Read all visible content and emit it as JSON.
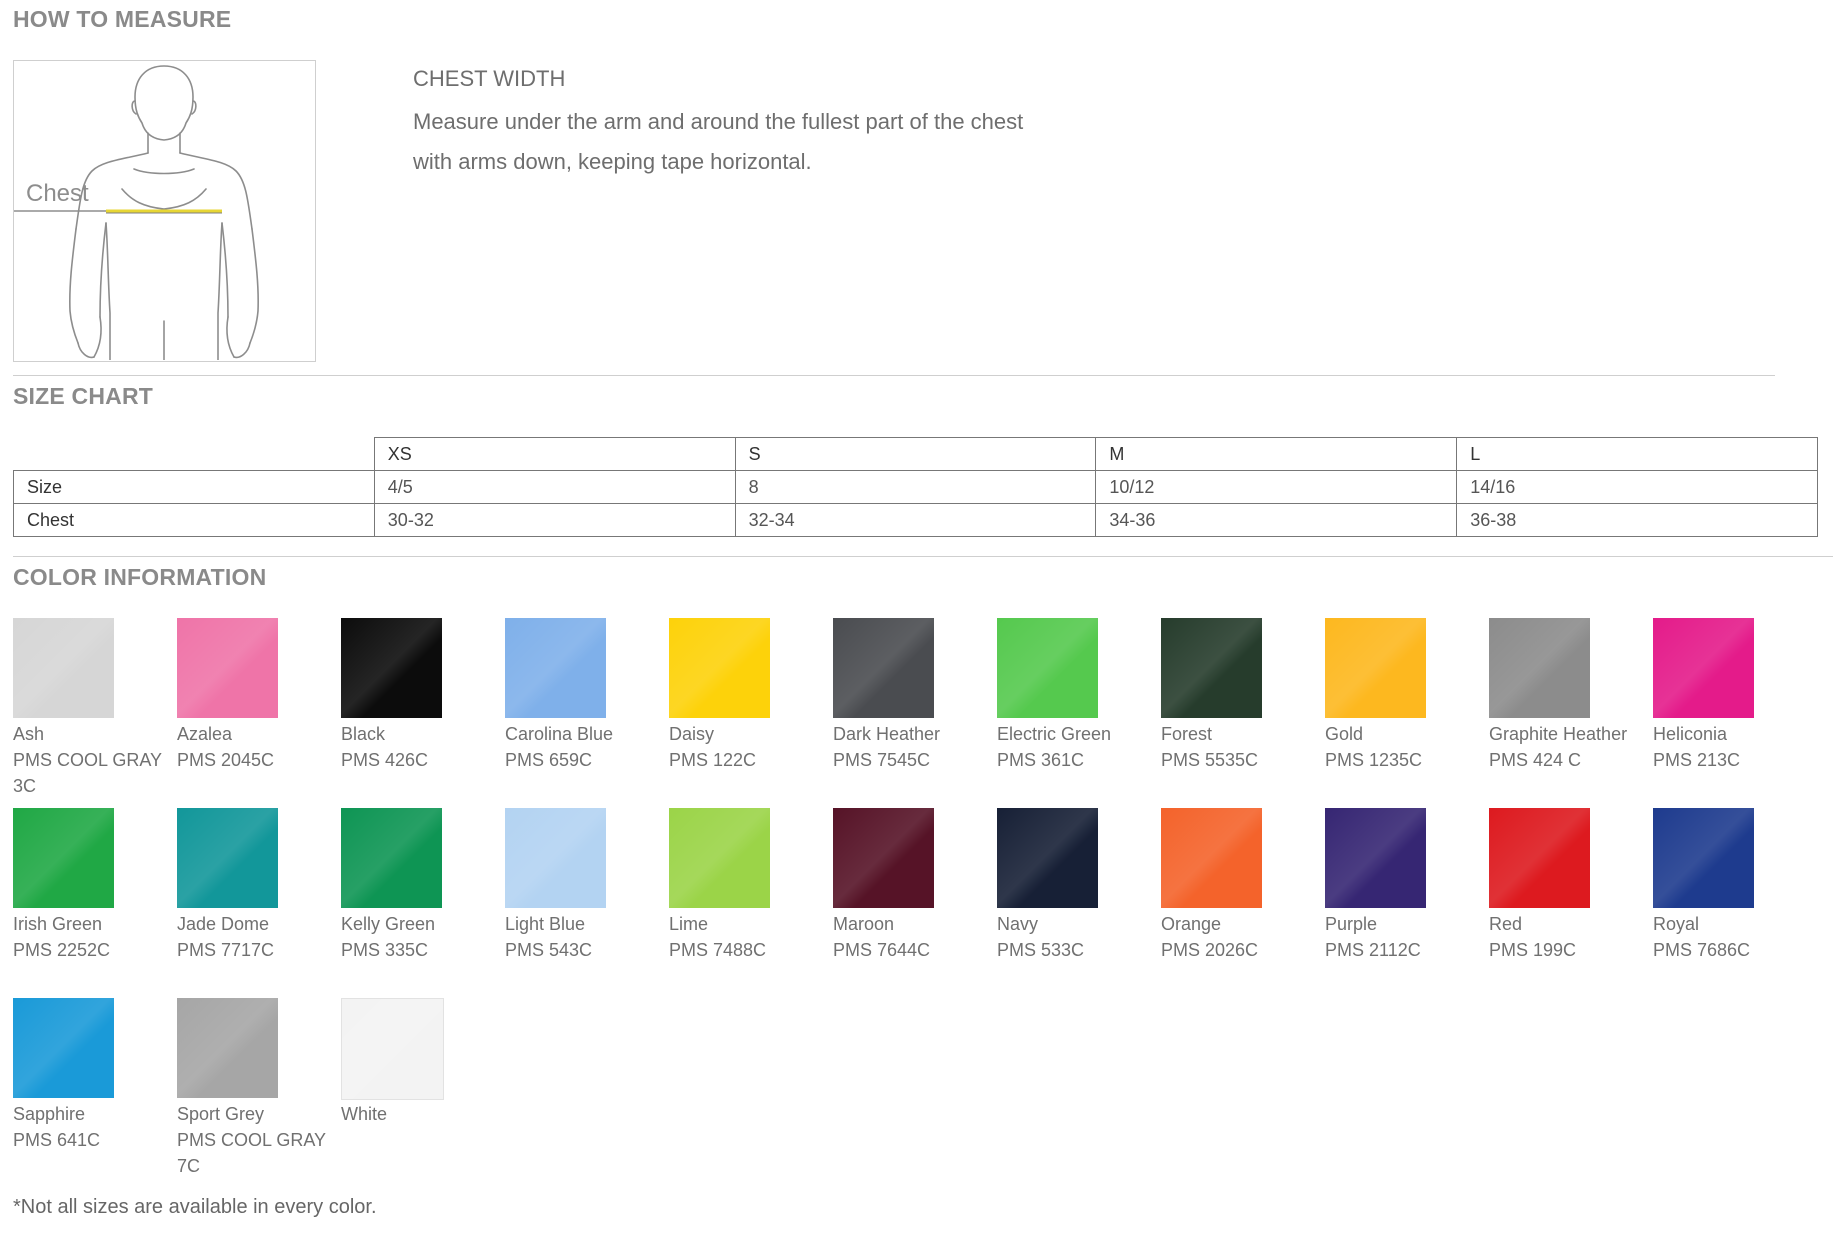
{
  "how_to_measure": {
    "title": "HOW TO MEASURE",
    "figure_label": "Chest",
    "heading": "CHEST WIDTH",
    "line1": "Measure under the arm and around the fullest part of the chest",
    "line2": "with arms down, keeping tape horizontal."
  },
  "size_chart": {
    "title": "SIZE CHART",
    "columns": [
      "XS",
      "S",
      "M",
      "L"
    ],
    "rows": [
      {
        "label": "Size",
        "values": [
          "4/5",
          "8",
          "10/12",
          "14/16"
        ]
      },
      {
        "label": "Chest",
        "values": [
          "30-32",
          "32-34",
          "34-36",
          "36-38"
        ]
      }
    ]
  },
  "color_info": {
    "title": "COLOR INFORMATION",
    "colors": [
      {
        "name": "Ash",
        "pms": "PMS COOL GRAY 3C",
        "hex": "#d6d6d6"
      },
      {
        "name": "Azalea",
        "pms": "PMS 2045C",
        "hex": "#ef74a8"
      },
      {
        "name": "Black",
        "pms": "PMS 426C",
        "hex": "#0c0c0c"
      },
      {
        "name": "Carolina Blue",
        "pms": "PMS 659C",
        "hex": "#7fb0ea"
      },
      {
        "name": "Daisy",
        "pms": "PMS 122C",
        "hex": "#fdd20a"
      },
      {
        "name": "Dark Heather",
        "pms": "PMS 7545C",
        "hex": "#4a4c50"
      },
      {
        "name": "Electric Green",
        "pms": "PMS 361C",
        "hex": "#55c94e"
      },
      {
        "name": "Forest",
        "pms": "PMS 5535C",
        "hex": "#263c2c"
      },
      {
        "name": "Gold",
        "pms": "PMS 1235C",
        "hex": "#fdb81f"
      },
      {
        "name": "Graphite Heather",
        "pms": "PMS 424 C",
        "hex": "#8c8c8c"
      },
      {
        "name": "Heliconia",
        "pms": "PMS 213C",
        "hex": "#e41b8a"
      },
      {
        "name": "Irish Green",
        "pms": "PMS 2252C",
        "hex": "#20a845"
      },
      {
        "name": "Jade Dome",
        "pms": "PMS 7717C",
        "hex": "#12979a"
      },
      {
        "name": "Kelly Green",
        "pms": "PMS 335C",
        "hex": "#0e9554"
      },
      {
        "name": "Light Blue",
        "pms": "PMS 543C",
        "hex": "#b3d3f2"
      },
      {
        "name": "Lime",
        "pms": "PMS 7488C",
        "hex": "#9bd448"
      },
      {
        "name": "Maroon",
        "pms": "PMS 7644C",
        "hex": "#561327"
      },
      {
        "name": "Navy",
        "pms": "PMS 533C",
        "hex": "#172036"
      },
      {
        "name": "Orange",
        "pms": "PMS 2026C",
        "hex": "#f4632b"
      },
      {
        "name": "Purple",
        "pms": "PMS 2112C",
        "hex": "#362673"
      },
      {
        "name": "Red",
        "pms": "PMS 199C",
        "hex": "#dd1a1f"
      },
      {
        "name": "Royal",
        "pms": "PMS 7686C",
        "hex": "#1e3b8e"
      },
      {
        "name": "Sapphire",
        "pms": "PMS 641C",
        "hex": "#1a9ad8"
      },
      {
        "name": "Sport Grey",
        "pms": "PMS COOL GRAY 7C",
        "hex": "#a6a6a6"
      },
      {
        "name": "White",
        "pms": "",
        "hex": "#f3f3f3"
      }
    ]
  },
  "footnote": "*Not all sizes are available in every color."
}
